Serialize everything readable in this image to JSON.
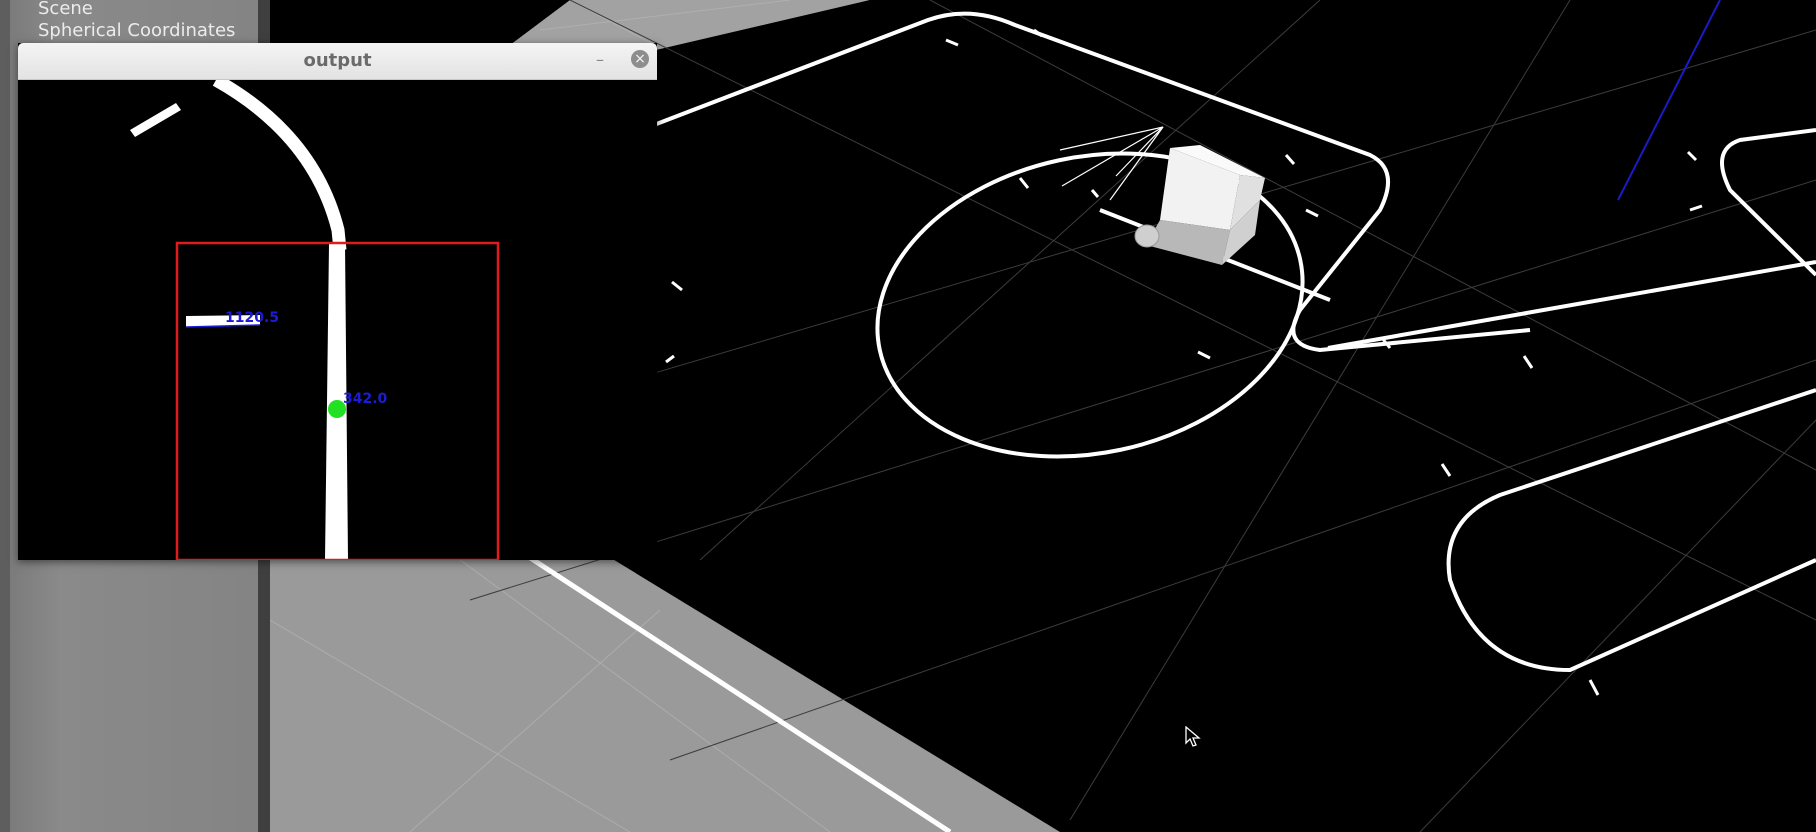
{
  "scene_tree": {
    "items": [
      {
        "label": "Scene"
      },
      {
        "label": "Spherical Coordinates"
      }
    ]
  },
  "output_window": {
    "title": "output",
    "minimize_label": "–",
    "close_label": "×",
    "annotations": {
      "left_value": "1120.5",
      "center_value": "342.0"
    },
    "colors": {
      "roi_box": "#e01b1b",
      "centroid_dot": "#22e022",
      "annotation_text": "#1c1cd8"
    }
  },
  "viewport": {
    "colors": {
      "ground": "#9a9a9a",
      "track_surface": "#000000",
      "track_line": "#ffffff",
      "robot_body": "#f0f0f0",
      "axis_line": "#1a1ac8"
    },
    "icons": {
      "cursor": "mouse-pointer-icon",
      "robot": "robot-model-icon"
    }
  }
}
